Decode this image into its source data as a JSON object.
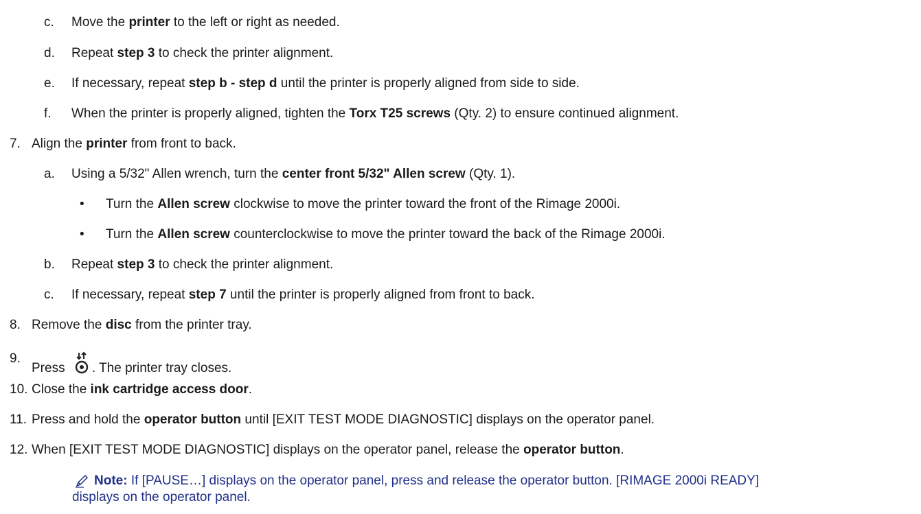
{
  "items": [
    {
      "num": "c.",
      "parts": [
        [
          "Move the ",
          0
        ],
        [
          "printer",
          1
        ],
        [
          " to the left or right as needed.",
          0
        ]
      ]
    },
    {
      "num": "d.",
      "parts": [
        [
          "Repeat ",
          0
        ],
        [
          "step 3",
          1
        ],
        [
          " to check the printer alignment.",
          0
        ]
      ]
    },
    {
      "num": "e.",
      "parts": [
        [
          "If necessary, repeat  ",
          0
        ],
        [
          "step b - step d",
          1
        ],
        [
          " until the printer is properly aligned from side to side.",
          0
        ]
      ]
    },
    {
      "num": "f.",
      "parts": [
        [
          "When the printer is properly aligned, tighten the ",
          0
        ],
        [
          "Torx T25 screws",
          1
        ],
        [
          " (Qty. 2) to ensure continued alignment.",
          0
        ]
      ]
    },
    {
      "num": "7.",
      "parts": [
        [
          "Align the ",
          0
        ],
        [
          "printer",
          1
        ],
        [
          " from front to back.",
          0
        ]
      ]
    },
    {
      "num": "a.",
      "parts": [
        [
          "Using a 5/32\" Allen wrench, turn the ",
          0
        ],
        [
          "center front 5/32\" Allen screw",
          1
        ],
        [
          " (Qty. 1).",
          0
        ]
      ]
    },
    {
      "num": "•",
      "parts": [
        [
          "Turn the ",
          0
        ],
        [
          "Allen screw",
          1
        ],
        [
          " clockwise to move the printer toward the front of the Rimage 2000i.",
          0
        ]
      ]
    },
    {
      "num": "•",
      "parts": [
        [
          "Turn the ",
          0
        ],
        [
          "Allen screw",
          1
        ],
        [
          " counterclockwise to move the printer toward the back of the Rimage 2000i.",
          0
        ]
      ]
    },
    {
      "num": "b.",
      "parts": [
        [
          "Repeat ",
          0
        ],
        [
          "step 3",
          1
        ],
        [
          " to check the printer alignment.",
          0
        ]
      ]
    },
    {
      "num": "c.",
      "parts": [
        [
          "If necessary, repeat ",
          0
        ],
        [
          "step 7",
          1
        ],
        [
          " until the printer is properly aligned from front to back.",
          0
        ]
      ]
    },
    {
      "num": "8.",
      "parts": [
        [
          "Remove the ",
          0
        ],
        [
          "disc",
          1
        ],
        [
          " from the printer tray.",
          0
        ]
      ]
    },
    {
      "num": "9.",
      "parts": [
        [
          "Press ",
          0
        ],
        [
          "",
          2
        ],
        [
          ". The printer tray closes.",
          0
        ]
      ]
    },
    {
      "num": "10.",
      "parts": [
        [
          "Close the ",
          0
        ],
        [
          "ink cartridge access door",
          1
        ],
        [
          ".",
          0
        ]
      ]
    },
    {
      "num": "11.",
      "parts": [
        [
          "Press and hold the ",
          0
        ],
        [
          "operator button",
          1
        ],
        [
          " until [EXIT TEST MODE DIAGNOSTIC] displays on the operator panel.",
          0
        ]
      ]
    },
    {
      "num": "12.",
      "parts": [
        [
          "When [EXIT TEST MODE DIAGNOSTIC] displays on the operator panel, release the ",
          0
        ],
        [
          "operator button",
          1
        ],
        [
          ".",
          0
        ]
      ]
    }
  ],
  "note": {
    "label": "Note:",
    "line1": " If [PAUSE…] displays on the operator panel, press and release the operator button. [RIMAGE 2000i READY]",
    "line2": "displays on the operator panel.",
    "icon": "pencil-note-icon"
  },
  "press_icon": "tray-eject-icon"
}
